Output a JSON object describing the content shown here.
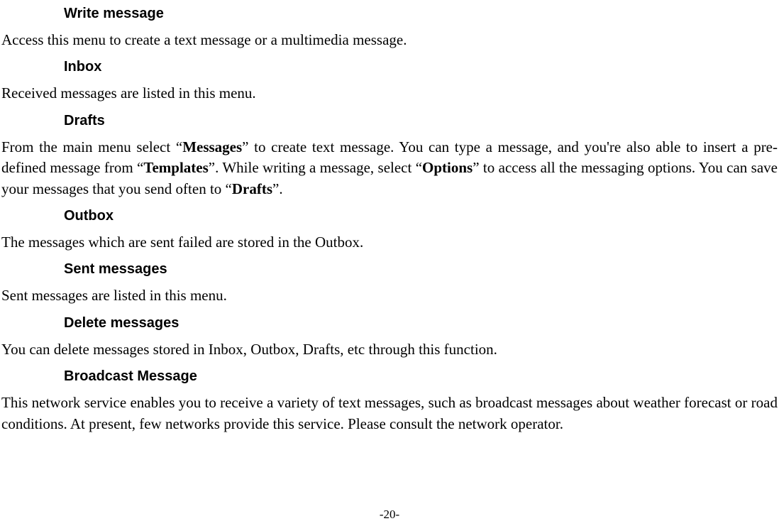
{
  "sections": {
    "write_message": {
      "heading": "Write message",
      "body_pre": "Access this menu to create a text message or a multimedia message."
    },
    "inbox": {
      "heading": "Inbox",
      "body": "Received messages are listed in this menu."
    },
    "drafts": {
      "heading": "Drafts",
      "body_part1": "From the main menu select “",
      "bold1": "Messages",
      "body_part2": "” to create text message. You can type a message, and you're also able to insert a pre-defined message from “",
      "bold2": "Templates",
      "body_part3": "”. While writing a message, select “",
      "bold3": "Options",
      "body_part4": "” to access all the messaging options. You can save your messages that you send often to “",
      "bold4": "Drafts",
      "body_part5": "”."
    },
    "outbox": {
      "heading": "Outbox",
      "body": "The messages which are sent failed are stored in the Outbox."
    },
    "sent": {
      "heading": "Sent messages",
      "body": "Sent messages are listed in this menu."
    },
    "delete": {
      "heading": "Delete messages",
      "body": "You can delete messages stored in Inbox, Outbox, Drafts, etc through this function."
    },
    "broadcast": {
      "heading": "Broadcast Message",
      "body": "This network service enables you to receive a variety of text messages, such as broadcast messages about weather forecast or road conditions. At present, few networks provide this service. Please consult the network operator."
    }
  },
  "page_number": "-20-"
}
